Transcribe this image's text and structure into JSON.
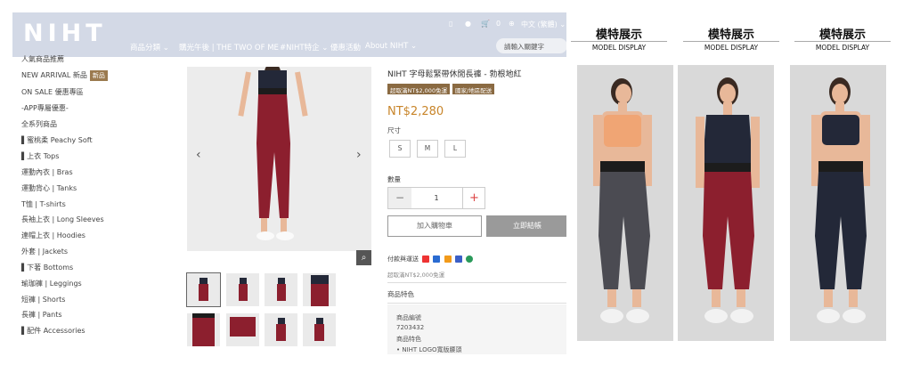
{
  "header": {
    "logo": "NIHT",
    "util_cart_count": "0",
    "util_lang": "中文 (繁體)",
    "nav": [
      "商品分類",
      "購光午後 | THE TWO OF ME",
      "#NIHT特企",
      "優惠活動",
      "About NIHT"
    ],
    "search_placeholder": "請輸入關鍵字"
  },
  "sidebar": {
    "items": [
      "人氣商品推薦",
      "NEW ARRIVAL 新品",
      "ON SALE 優惠專區",
      "-APP專屬優惠-",
      "全系列商品",
      "▌蜜桃柔 Peachy Soft",
      "▌上衣 Tops",
      "運動內衣 | Bras",
      "運動背心 | Tanks",
      "T恤 | T-shirts",
      "長袖上衣 | Long Sleeves",
      "連帽上衣 | Hoodies",
      "外套 | Jackets",
      "▌下著 Bottoms",
      "瑜珈褲 | Leggings",
      "短褲 | Shorts",
      "長褲 | Pants",
      "▌配件 Accessories"
    ],
    "new_tag": "新品"
  },
  "product": {
    "title": "NIHT 字母鬆緊帶休閒長褲 - 勃根地紅",
    "badges": [
      "超取滿NT$2,000免運",
      "國家/地區配送"
    ],
    "price": "NT$2,280",
    "size_label": "尺寸",
    "sizes": [
      "S",
      "M",
      "L"
    ],
    "qty_label": "數量",
    "qty_value": "1",
    "add_to_cart": "加入購物車",
    "buy_now": "立即結帳",
    "payment_label": "付款與運送",
    "shipping_note": "超取滿NT$2,000免運",
    "features_label": "商品特色",
    "feature_lines": [
      "商品編號",
      "7203432",
      "商品特色",
      "• NIHT LOGO寬版腰頭"
    ]
  },
  "models": {
    "title": "模特展示",
    "subtitle": "MODEL DISPLAY",
    "colors": {
      "orange_top": "#f0a574",
      "navy": "#232838",
      "burgundy": "#8c1f2e",
      "grey_pants": "#4b4b52",
      "skin": "#e8b899",
      "hair": "#3a2a22"
    }
  }
}
